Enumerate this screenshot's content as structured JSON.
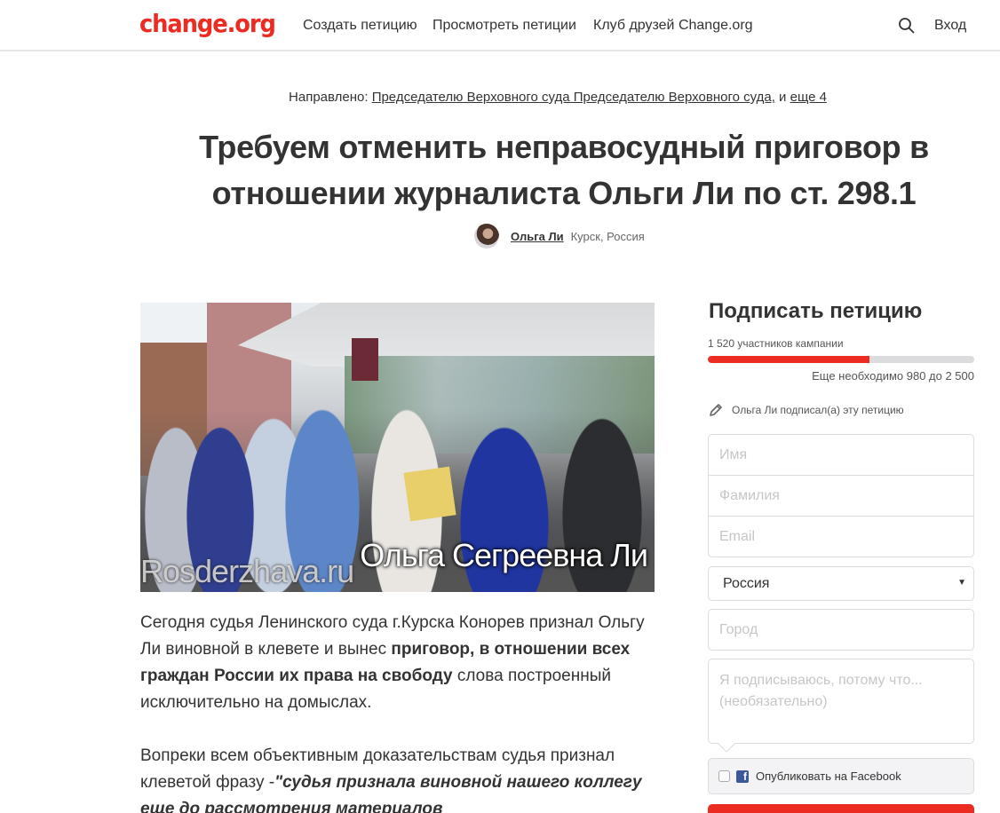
{
  "header": {
    "logo": "change.org",
    "nav": [
      {
        "label": "Создать петицию"
      },
      {
        "label": "Просмотреть петиции"
      },
      {
        "label": "Клуб друзей Change.org"
      }
    ],
    "search_icon": "search-icon",
    "login_label": "Вход"
  },
  "petition": {
    "directed_label": "Направлено:",
    "directed_target": "Председателю Верховного суда Председателю Верховного суда,",
    "directed_and": "и",
    "directed_more": "еще 4",
    "title": "Требуем отменить неправосудный приговор в отношении журналиста Ольги Ли по ст. 298.1",
    "author_name": "Ольга Ли",
    "author_location": "Курск, Россия",
    "photo": {
      "watermark": "Rosderzhava.ru",
      "caption": "Ольга Сегреевна Ли"
    },
    "body": {
      "p1_part1": "Сегодня судья Ленинского суда г.Курска Конорев признал Ольгу Ли виновной в клевете и вынес ",
      "p1_bold": "приговор, в отношении  всех граждан России их права на свободу",
      "p1_part2": " слова построенный исключительно на домыслах.",
      "p2_part1": "Вопреки всем объективным доказательствам судья признал клеветой  фразу -",
      "p2_bold_italic": "\"судья признала виновной нашего коллегу еще до рассмотрения материалов"
    }
  },
  "sidebar": {
    "title": "Подписать петицию",
    "supporters": "1 520 участников кампании",
    "progress_percent": 60.8,
    "needed": "Еще необходимо 980 до 2 500",
    "signed_by": "Ольга Ли подписал(а) эту петицию",
    "form": {
      "first_name_placeholder": "Имя",
      "last_name_placeholder": "Фамилия",
      "email_placeholder": "Email",
      "country_value": "Россия",
      "city_placeholder": "Город",
      "reason_placeholder": "Я подписываюсь, потому что... (необязательно)",
      "facebook_label": "Опубликовать на Facebook"
    }
  },
  "colors": {
    "brand": "#ec2c22",
    "facebook": "#3b5998",
    "progress_track": "#dcdbde"
  }
}
